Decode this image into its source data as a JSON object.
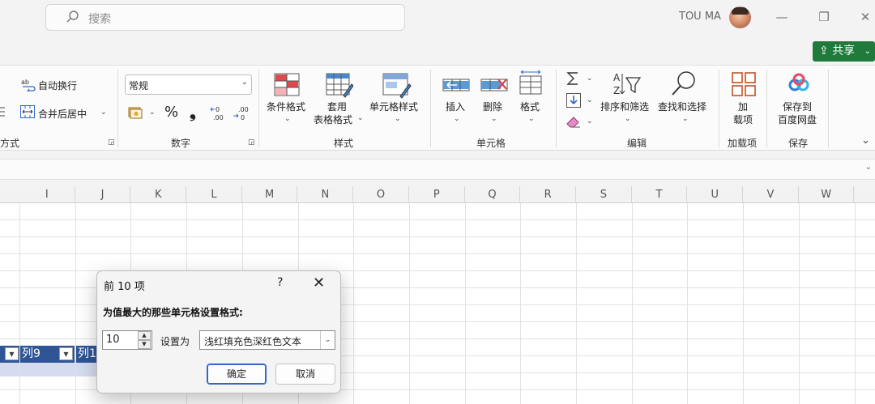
{
  "titlebar": {
    "search_placeholder": "搜索",
    "user_name": "TOU MA",
    "minimize": "—",
    "restore": "❐",
    "close": "✕"
  },
  "share": {
    "label": "共享",
    "icon": "share-icon"
  },
  "ribbon": {
    "alignment": {
      "wrap_text": "自动换行",
      "merge_center": "合并后居中",
      "group_label": "方式"
    },
    "number": {
      "format_value": "常规",
      "percent": "%",
      "comma": "❟",
      "group_label": "数字"
    },
    "styles": {
      "conditional_format": "条件格式",
      "format_table_line1": "套用",
      "format_table_line2": "表格格式",
      "cell_styles": "单元格样式",
      "group_label": "样式"
    },
    "cells": {
      "insert": "插入",
      "delete": "删除",
      "format": "格式",
      "group_label": "单元格"
    },
    "editing": {
      "sort_filter": "排序和筛选",
      "find_select": "查找和选择",
      "group_label": "编辑"
    },
    "addins": {
      "addin_line1": "加",
      "addin_line2": "载项",
      "group_label": "加载项"
    },
    "save": {
      "save_line1": "保存到",
      "save_line2": "百度网盘",
      "group_label": "保存"
    }
  },
  "grid": {
    "columns": [
      "I",
      "J",
      "K",
      "L",
      "M",
      "N",
      "O",
      "P",
      "Q",
      "R",
      "S",
      "T",
      "U",
      "V",
      "W"
    ],
    "table_headers": [
      "列9",
      "列1"
    ]
  },
  "dialog": {
    "title": "前 10 项",
    "help": "?",
    "close": "✕",
    "prompt": "为值最大的那些单元格设置格式:",
    "count_value": "10",
    "set_as_label": "设置为",
    "format_option": "浅红填充色深红色文本",
    "ok": "确定",
    "cancel": "取消"
  },
  "colors": {
    "share_green": "#1f7a3c",
    "table_header": "#2f5597",
    "table_band": "#d6dcf0",
    "ok_border": "#2f69c8"
  }
}
